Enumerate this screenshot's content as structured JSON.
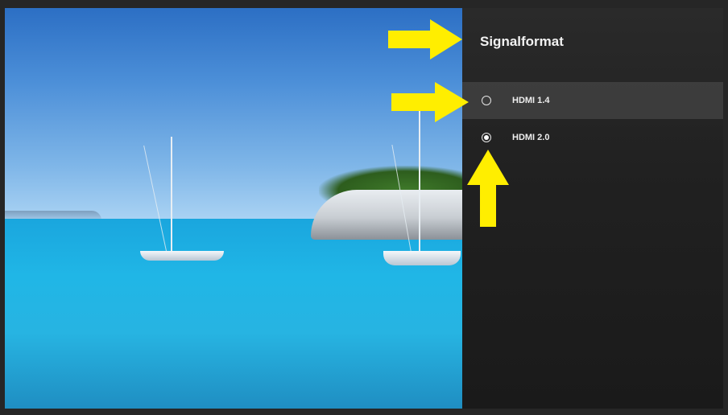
{
  "panel": {
    "title": "Signalformat",
    "options": [
      {
        "label": "HDMI 1.4",
        "selected": false,
        "focused": true
      },
      {
        "label": "HDMI 2.0",
        "selected": true,
        "focused": false
      }
    ]
  },
  "annotations": {
    "arrow_color": "#ffee00",
    "arrows": [
      {
        "name": "arrow-to-title",
        "direction": "right"
      },
      {
        "name": "arrow-to-hdmi-1-4",
        "direction": "right"
      },
      {
        "name": "arrow-to-hdmi-2-0",
        "direction": "up"
      }
    ]
  },
  "icons": {
    "unselected": "radio-unchecked-icon",
    "selected": "radio-checked-icon"
  },
  "colors": {
    "panel_bg": "#212121",
    "focus_highlight": "#505050",
    "text": "#f2f2f2"
  }
}
